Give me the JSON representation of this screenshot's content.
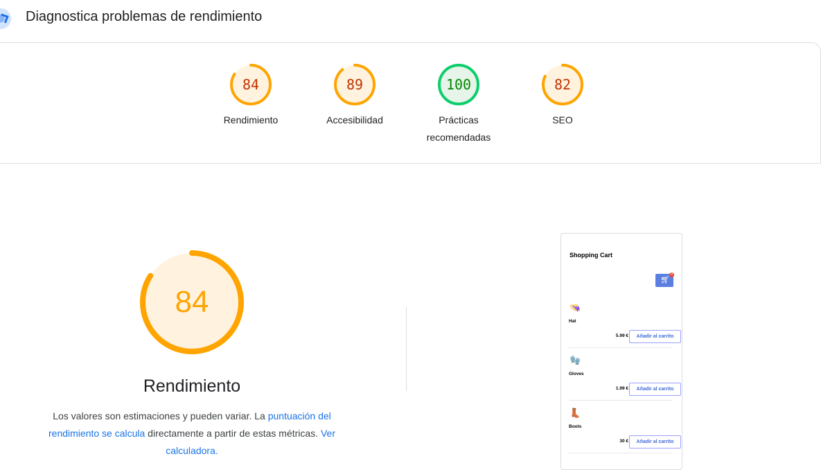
{
  "header": {
    "title": "Diagnostica problemas de rendimiento"
  },
  "categories": [
    {
      "label": "Rendimiento",
      "score": 84,
      "color": "#ffa400",
      "text_color": "#c33300",
      "bg": "#fff3e0"
    },
    {
      "label": "Accesibilidad",
      "score": 89,
      "color": "#ffa400",
      "text_color": "#c33300",
      "bg": "#fff3e0"
    },
    {
      "label": "Prácticas recomendadas",
      "line1": "Prácticas",
      "line2": "recomendadas",
      "score": 100,
      "color": "#0cce6b",
      "text_color": "#008800",
      "bg": "#e6f4ea"
    },
    {
      "label": "SEO",
      "score": 82,
      "color": "#ffa400",
      "text_color": "#c33300",
      "bg": "#fff3e0"
    }
  ],
  "performance": {
    "score": 84,
    "title": "Rendimiento",
    "desc_part1": "Los valores son estimaciones y pueden variar. La ",
    "link1": "puntuación del rendimiento se calcula",
    "desc_part2": " directamente a partir de estas métricas. ",
    "link2": "Ver calculadora."
  },
  "screenshot": {
    "title": "Shopping Cart",
    "cart_icon": "cart-icon",
    "cart_badge": "0",
    "products": [
      {
        "name": "Hat",
        "emoji": "👒",
        "price": "5.99 €",
        "button": "Añadir al carrito"
      },
      {
        "name": "Gloves",
        "emoji": "🧤",
        "price": "1.99 €",
        "button": "Añadir al carrito"
      },
      {
        "name": "Boots",
        "emoji": "👢",
        "price": "30 €",
        "button": "Añadir al carrito"
      }
    ]
  }
}
